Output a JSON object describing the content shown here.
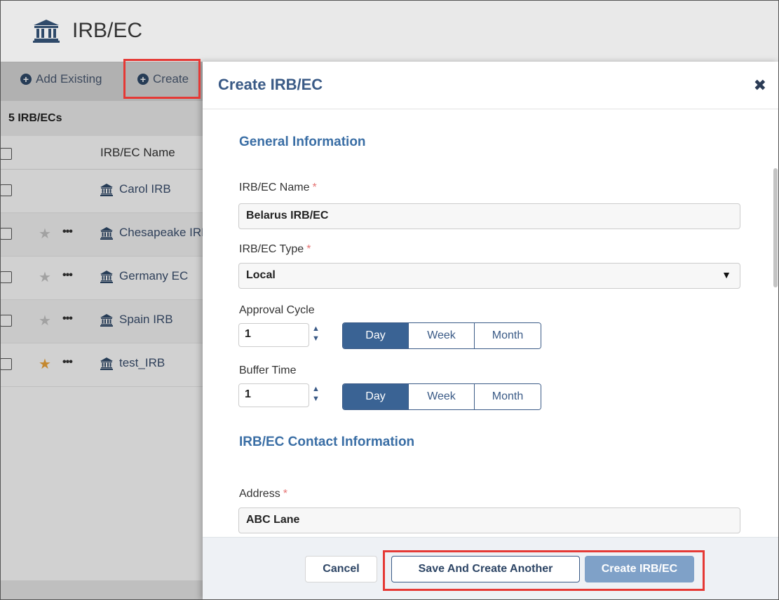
{
  "page": {
    "title": "IRB/EC",
    "toolbar": {
      "add_existing": "Add Existing",
      "create": "Create"
    },
    "count_label": "5 IRB/ECs",
    "table": {
      "column_name": "IRB/EC Name",
      "rows": [
        {
          "name": "Carol IRB",
          "favorite": false,
          "show_actions": false
        },
        {
          "name": "Chesapeake IRB",
          "favorite": false,
          "show_actions": true
        },
        {
          "name": "Germany EC",
          "favorite": false,
          "show_actions": true
        },
        {
          "name": "Spain IRB",
          "favorite": false,
          "show_actions": true
        },
        {
          "name": "test_IRB",
          "favorite": true,
          "show_actions": true
        }
      ]
    }
  },
  "modal": {
    "title": "Create IRB/EC",
    "close_glyph": "✖",
    "general_section": "General Information",
    "name_label": "IRB/EC Name",
    "name_value": "Belarus IRB/EC",
    "type_label": "IRB/EC Type",
    "type_value": "Local",
    "approval_label": "Approval Cycle",
    "approval_value": "1",
    "buffer_label": "Buffer Time",
    "buffer_value": "1",
    "period_options": [
      "Day",
      "Week",
      "Month"
    ],
    "approval_selected": "Day",
    "buffer_selected": "Day",
    "contact_section": "IRB/EC Contact Information",
    "address_label": "Address",
    "address_value": "ABC Lane",
    "required_marker": "*"
  },
  "footer": {
    "cancel": "Cancel",
    "save_and_create_another": "Save And Create Another",
    "create": "Create IRB/EC"
  },
  "colors": {
    "accent": "#3a5a86",
    "active_segment": "#3a6394",
    "primary_button": "#7fa1c8",
    "highlight": "#e53935",
    "favorite_star": "#f0a63a"
  },
  "icons": {
    "institution": "institution-icon",
    "plus": "plus-circle-icon",
    "star": "star-icon",
    "more": "ellipsis-icon",
    "close": "close-icon",
    "caret": "caret-down-icon"
  }
}
